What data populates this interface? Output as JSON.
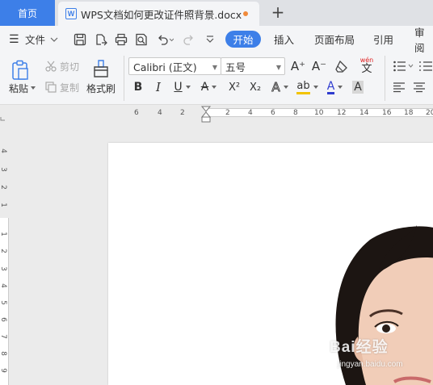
{
  "tabs": {
    "home_label": "首页",
    "doc_logo": "W",
    "doc_title": "WPS文档如何更改证件照背景.docx",
    "new_tab_glyph": "+"
  },
  "menu": {
    "hamburger_glyph": "☰",
    "file_label": "文件",
    "active_tab": "开始",
    "tabs": [
      "插入",
      "页面布局",
      "引用",
      "审阅"
    ]
  },
  "toolbar": {
    "paste": "粘贴",
    "cut": "剪切",
    "copy": "复制",
    "format_painter": "格式刷",
    "font_name": "Calibri (正文)",
    "font_size": "五号",
    "grow_font": "A⁺",
    "shrink_font": "A⁻",
    "pinyin": "wén",
    "bold": "B",
    "italic": "I",
    "underline": "U",
    "strike": "A",
    "superscript": "X²",
    "subscript": "X₂",
    "text_effect": "A",
    "highlight": "ab",
    "font_color": "A",
    "char_shading": "A"
  },
  "ruler": {
    "h_ticks": [
      "6",
      "4",
      "2",
      "2",
      "4",
      "6",
      "8",
      "10",
      "12",
      "14",
      "16",
      "18",
      "20"
    ],
    "v_ticks_top": [
      "4",
      "3",
      "2",
      "1"
    ],
    "v_ticks_bottom": [
      "1",
      "2",
      "3",
      "4",
      "5",
      "6",
      "7",
      "8",
      "9"
    ]
  },
  "watermark": {
    "brand": "Bai经验",
    "url": "jingyan.baidu.com"
  },
  "colors": {
    "accent": "#3d7fe8",
    "modified_dot": "#f08a3a",
    "font_color_bar": "#e02020"
  }
}
